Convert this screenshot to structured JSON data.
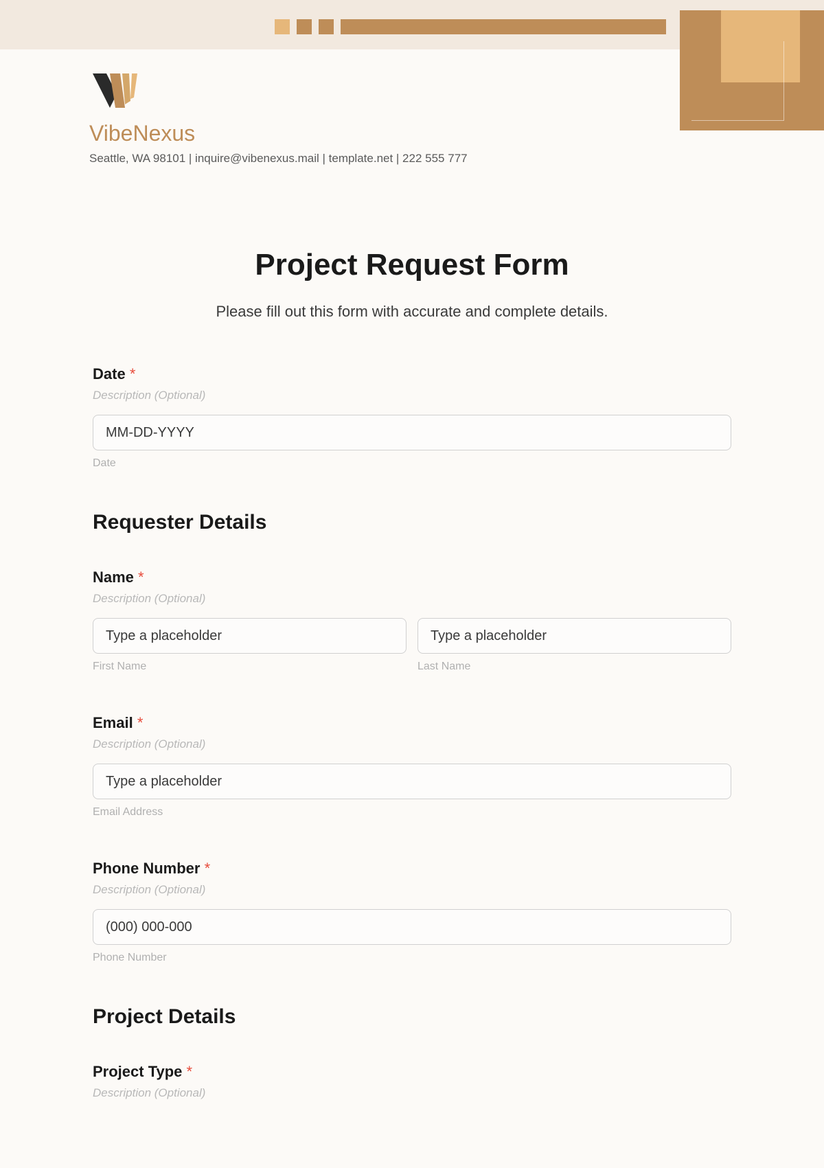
{
  "header": {
    "brand": "VibeNexus",
    "contact": "Seattle, WA 98101 | inquire@vibenexus.mail | template.net | 222 555 777"
  },
  "form": {
    "title": "Project Request Form",
    "subtitle": "Please fill out this form with accurate and complete details.",
    "desc_placeholder": "Description (Optional)",
    "date": {
      "label": "Date",
      "placeholder": "MM-DD-YYYY",
      "sublabel": "Date"
    },
    "sections": {
      "requester": "Requester Details",
      "project": "Project Details"
    },
    "name": {
      "label": "Name",
      "placeholder": "Type a placeholder",
      "first_sub": "First Name",
      "last_sub": "Last Name"
    },
    "email": {
      "label": "Email",
      "placeholder": "Type a placeholder",
      "sublabel": "Email Address"
    },
    "phone": {
      "label": "Phone Number",
      "placeholder": "(000) 000-000",
      "sublabel": "Phone Number"
    },
    "project_type": {
      "label": "Project Type",
      "desc": "Description (Optional)"
    },
    "required_mark": "*"
  }
}
